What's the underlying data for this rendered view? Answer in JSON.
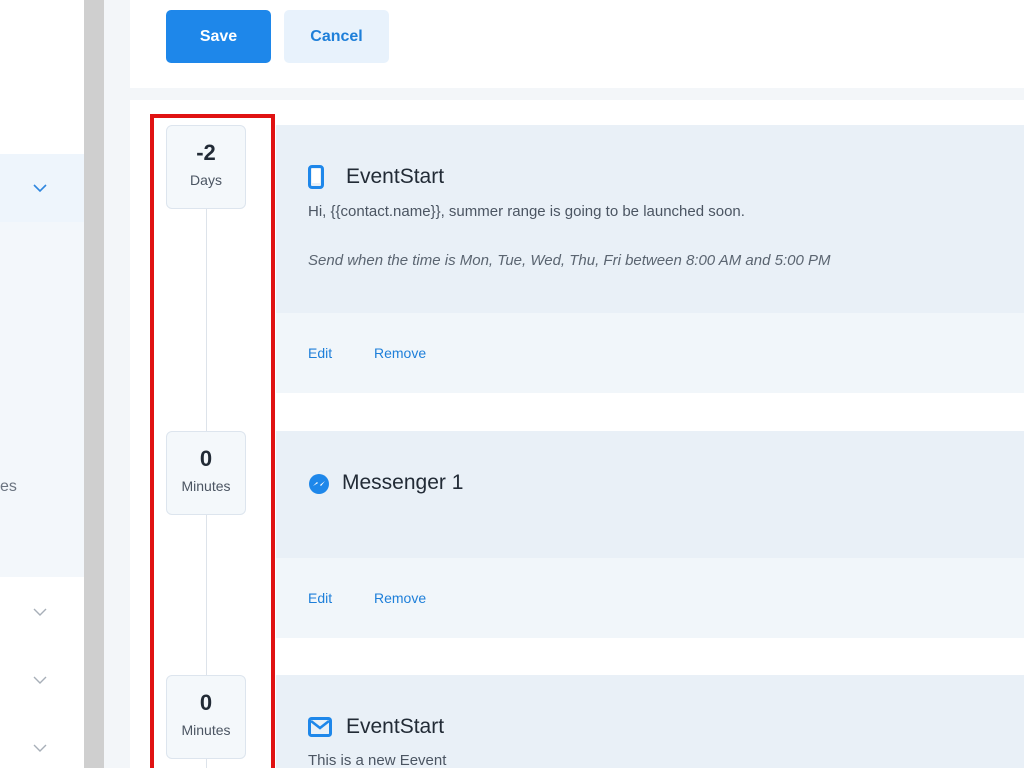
{
  "sidebar": {
    "partial_label": "es"
  },
  "toolbar": {
    "save_label": "Save",
    "cancel_label": "Cancel"
  },
  "steps": [
    {
      "delay_value": "-2",
      "delay_unit": "Days",
      "channel_icon": "mobile-phone-icon",
      "title": "EventStart",
      "message": "Hi, {{contact.name}}, summer range is going to be launched soon.",
      "schedule": "Send when the time is Mon, Tue, Wed, Thu, Fri between 8:00 AM and 5:00 PM",
      "edit_label": "Edit",
      "remove_label": "Remove"
    },
    {
      "delay_value": "0",
      "delay_unit": "Minutes",
      "channel_icon": "messenger-icon",
      "title": "Messenger 1",
      "edit_label": "Edit",
      "remove_label": "Remove"
    },
    {
      "delay_value": "0",
      "delay_unit": "Minutes",
      "channel_icon": "email-icon",
      "title": "EventStart",
      "message": "This is a new Eevent"
    }
  ],
  "colors": {
    "primary": "#1e87ea",
    "highlight": "#e01212"
  }
}
